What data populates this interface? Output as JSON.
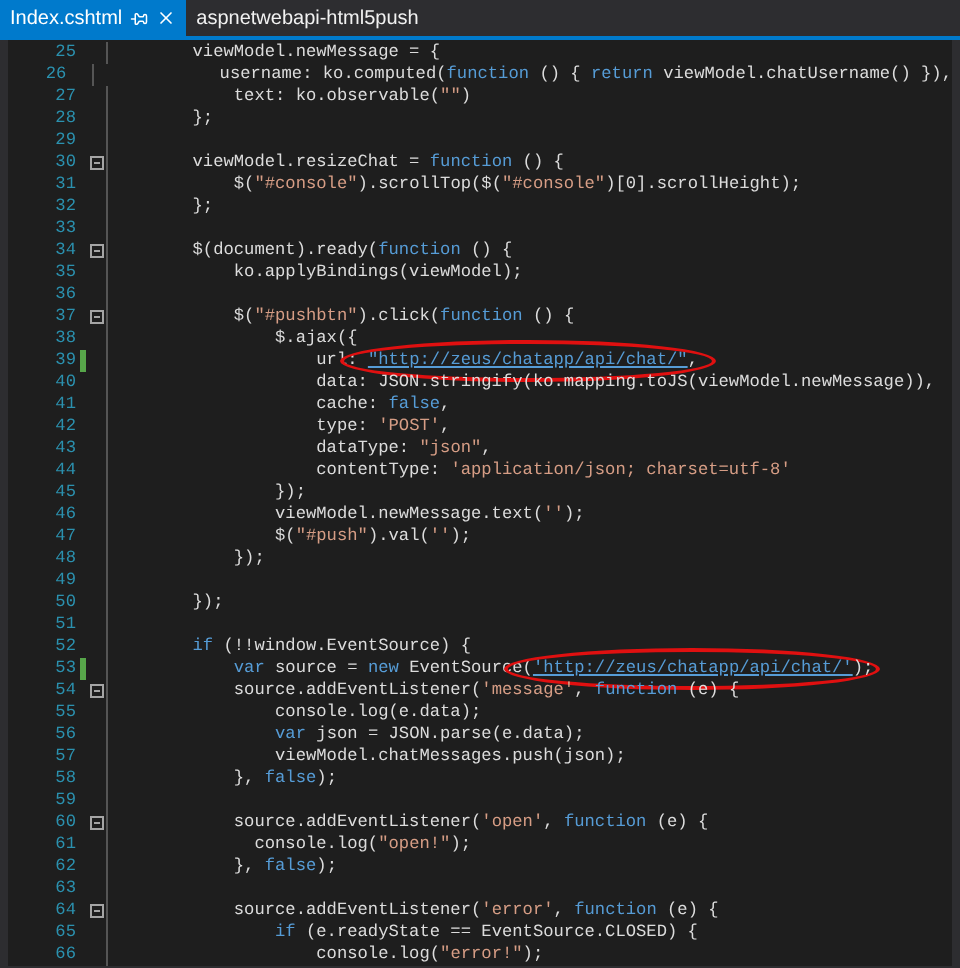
{
  "tabs": [
    {
      "label": "Index.cshtml",
      "selected": true,
      "pinnable": true,
      "closable": true
    },
    {
      "label": "aspnetwebapi-html5push",
      "selected": false,
      "pinnable": false,
      "closable": false
    }
  ],
  "editor": {
    "lines": [
      {
        "number": "25",
        "fold": false,
        "changed": false,
        "segments": [
          {
            "kind": "plain",
            "text": "        viewModel.newMessage = {"
          }
        ]
      },
      {
        "number": "26",
        "fold": false,
        "changed": false,
        "segments": [
          {
            "kind": "plain",
            "text": "            username: ko.computed("
          },
          {
            "kind": "keyword",
            "text": "function"
          },
          {
            "kind": "plain",
            "text": " () { "
          },
          {
            "kind": "keyword",
            "text": "return"
          },
          {
            "kind": "plain",
            "text": " viewModel.chatUsername() }),"
          }
        ]
      },
      {
        "number": "27",
        "fold": false,
        "changed": false,
        "segments": [
          {
            "kind": "plain",
            "text": "            text: ko.observable("
          },
          {
            "kind": "string",
            "text": "\"\""
          },
          {
            "kind": "plain",
            "text": ")"
          }
        ]
      },
      {
        "number": "28",
        "fold": false,
        "changed": false,
        "segments": [
          {
            "kind": "plain",
            "text": "        };"
          }
        ]
      },
      {
        "number": "29",
        "fold": false,
        "changed": false
      },
      {
        "number": "30",
        "fold": true,
        "changed": false,
        "segments": [
          {
            "kind": "plain",
            "text": "        viewModel.resizeChat = "
          },
          {
            "kind": "keyword",
            "text": "function"
          },
          {
            "kind": "plain",
            "text": " () {"
          }
        ]
      },
      {
        "number": "31",
        "fold": false,
        "changed": false,
        "segments": [
          {
            "kind": "plain",
            "text": "            $("
          },
          {
            "kind": "string",
            "text": "\"#console\""
          },
          {
            "kind": "plain",
            "text": ").scrollTop($("
          },
          {
            "kind": "string",
            "text": "\"#console\""
          },
          {
            "kind": "plain",
            "text": ")[0].scrollHeight);"
          }
        ]
      },
      {
        "number": "32",
        "fold": false,
        "changed": false,
        "segments": [
          {
            "kind": "plain",
            "text": "        };"
          }
        ]
      },
      {
        "number": "33",
        "fold": false,
        "changed": false
      },
      {
        "number": "34",
        "fold": true,
        "changed": false,
        "segments": [
          {
            "kind": "plain",
            "text": "        $(document).ready("
          },
          {
            "kind": "keyword",
            "text": "function"
          },
          {
            "kind": "plain",
            "text": " () {"
          }
        ]
      },
      {
        "number": "35",
        "fold": false,
        "changed": false,
        "segments": [
          {
            "kind": "plain",
            "text": "            ko.applyBindings(viewModel);"
          }
        ]
      },
      {
        "number": "36",
        "fold": false,
        "changed": false
      },
      {
        "number": "37",
        "fold": true,
        "changed": false,
        "segments": [
          {
            "kind": "plain",
            "text": "            $("
          },
          {
            "kind": "string",
            "text": "\"#pushbtn\""
          },
          {
            "kind": "plain",
            "text": ").click("
          },
          {
            "kind": "keyword",
            "text": "function"
          },
          {
            "kind": "plain",
            "text": " () {"
          }
        ]
      },
      {
        "number": "38",
        "fold": false,
        "changed": false,
        "segments": [
          {
            "kind": "plain",
            "text": "                $.ajax({"
          }
        ]
      },
      {
        "number": "39",
        "fold": false,
        "changed": true,
        "segments": [
          {
            "kind": "plain",
            "text": "                    url: "
          },
          {
            "kind": "link",
            "text": "\"http://zeus/chatapp/api/chat/\"",
            "circled": true
          },
          {
            "kind": "plain",
            "text": ","
          }
        ]
      },
      {
        "number": "40",
        "fold": false,
        "changed": false,
        "segments": [
          {
            "kind": "plain",
            "text": "                    data: JSON.stringify(ko.mapping.toJS(viewModel.newMessage)),"
          }
        ]
      },
      {
        "number": "41",
        "fold": false,
        "changed": false,
        "segments": [
          {
            "kind": "plain",
            "text": "                    cache: "
          },
          {
            "kind": "keyword",
            "text": "false"
          },
          {
            "kind": "plain",
            "text": ","
          }
        ]
      },
      {
        "number": "42",
        "fold": false,
        "changed": false,
        "segments": [
          {
            "kind": "plain",
            "text": "                    type: "
          },
          {
            "kind": "string",
            "text": "'POST'"
          },
          {
            "kind": "plain",
            "text": ","
          }
        ]
      },
      {
        "number": "43",
        "fold": false,
        "changed": false,
        "segments": [
          {
            "kind": "plain",
            "text": "                    dataType: "
          },
          {
            "kind": "string",
            "text": "\"json\""
          },
          {
            "kind": "plain",
            "text": ","
          }
        ]
      },
      {
        "number": "44",
        "fold": false,
        "changed": false,
        "segments": [
          {
            "kind": "plain",
            "text": "                    contentType: "
          },
          {
            "kind": "string",
            "text": "'application/json; charset=utf-8'"
          }
        ]
      },
      {
        "number": "45",
        "fold": false,
        "changed": false,
        "segments": [
          {
            "kind": "plain",
            "text": "                });"
          }
        ]
      },
      {
        "number": "46",
        "fold": false,
        "changed": false,
        "segments": [
          {
            "kind": "plain",
            "text": "                viewModel.newMessage.text("
          },
          {
            "kind": "string",
            "text": "''"
          },
          {
            "kind": "plain",
            "text": ");"
          }
        ]
      },
      {
        "number": "47",
        "fold": false,
        "changed": false,
        "segments": [
          {
            "kind": "plain",
            "text": "                $("
          },
          {
            "kind": "string",
            "text": "\"#push\""
          },
          {
            "kind": "plain",
            "text": ").val("
          },
          {
            "kind": "string",
            "text": "''"
          },
          {
            "kind": "plain",
            "text": ");"
          }
        ]
      },
      {
        "number": "48",
        "fold": false,
        "changed": false,
        "segments": [
          {
            "kind": "plain",
            "text": "            });"
          }
        ]
      },
      {
        "number": "49",
        "fold": false,
        "changed": false
      },
      {
        "number": "50",
        "fold": false,
        "changed": false,
        "segments": [
          {
            "kind": "plain",
            "text": "        });"
          }
        ]
      },
      {
        "number": "51",
        "fold": false,
        "changed": false
      },
      {
        "number": "52",
        "fold": false,
        "changed": false,
        "segments": [
          {
            "kind": "keyword",
            "text": "        if"
          },
          {
            "kind": "plain",
            "text": " (!!window.EventSource) {"
          }
        ]
      },
      {
        "number": "53",
        "fold": false,
        "changed": true,
        "segments": [
          {
            "kind": "keyword",
            "text": "            var"
          },
          {
            "kind": "plain",
            "text": " source = "
          },
          {
            "kind": "keyword",
            "text": "new"
          },
          {
            "kind": "plain",
            "text": " EventSource("
          },
          {
            "kind": "link",
            "text": "'http://zeus/chatapp/api/chat/'",
            "circled": true
          },
          {
            "kind": "plain",
            "text": ");"
          }
        ]
      },
      {
        "number": "54",
        "fold": true,
        "changed": false,
        "segments": [
          {
            "kind": "plain",
            "text": "            source.addEventListener("
          },
          {
            "kind": "string",
            "text": "'message'"
          },
          {
            "kind": "plain",
            "text": ", "
          },
          {
            "kind": "keyword",
            "text": "function"
          },
          {
            "kind": "plain",
            "text": " (e) {"
          }
        ]
      },
      {
        "number": "55",
        "fold": false,
        "changed": false,
        "segments": [
          {
            "kind": "plain",
            "text": "                console.log(e.data);"
          }
        ]
      },
      {
        "number": "56",
        "fold": false,
        "changed": false,
        "segments": [
          {
            "kind": "keyword",
            "text": "                var"
          },
          {
            "kind": "plain",
            "text": " json = JSON.parse(e.data);"
          }
        ]
      },
      {
        "number": "57",
        "fold": false,
        "changed": false,
        "segments": [
          {
            "kind": "plain",
            "text": "                viewModel.chatMessages.push(json);"
          }
        ]
      },
      {
        "number": "58",
        "fold": false,
        "changed": false,
        "segments": [
          {
            "kind": "plain",
            "text": "            }, "
          },
          {
            "kind": "keyword",
            "text": "false"
          },
          {
            "kind": "plain",
            "text": ");"
          }
        ]
      },
      {
        "number": "59",
        "fold": false,
        "changed": false
      },
      {
        "number": "60",
        "fold": true,
        "changed": false,
        "segments": [
          {
            "kind": "plain",
            "text": "            source.addEventListener("
          },
          {
            "kind": "string",
            "text": "'open'"
          },
          {
            "kind": "plain",
            "text": ", "
          },
          {
            "kind": "keyword",
            "text": "function"
          },
          {
            "kind": "plain",
            "text": " (e) {"
          }
        ]
      },
      {
        "number": "61",
        "fold": false,
        "changed": false,
        "segments": [
          {
            "kind": "plain",
            "text": "              console.log("
          },
          {
            "kind": "string",
            "text": "\"open!\""
          },
          {
            "kind": "plain",
            "text": ");"
          }
        ]
      },
      {
        "number": "62",
        "fold": false,
        "changed": false,
        "segments": [
          {
            "kind": "plain",
            "text": "            }, "
          },
          {
            "kind": "keyword",
            "text": "false"
          },
          {
            "kind": "plain",
            "text": ");"
          }
        ]
      },
      {
        "number": "63",
        "fold": false,
        "changed": false
      },
      {
        "number": "64",
        "fold": true,
        "changed": false,
        "segments": [
          {
            "kind": "plain",
            "text": "            source.addEventListener("
          },
          {
            "kind": "string",
            "text": "'error'"
          },
          {
            "kind": "plain",
            "text": ", "
          },
          {
            "kind": "keyword",
            "text": "function"
          },
          {
            "kind": "plain",
            "text": " (e) {"
          }
        ]
      },
      {
        "number": "65",
        "fold": false,
        "changed": false,
        "segments": [
          {
            "kind": "keyword",
            "text": "                if"
          },
          {
            "kind": "plain",
            "text": " (e.readyState == EventSource.CLOSED) {"
          }
        ]
      },
      {
        "number": "66",
        "fold": false,
        "changed": false,
        "segments": [
          {
            "kind": "plain",
            "text": "                    console.log("
          },
          {
            "kind": "string",
            "text": "\"error!\""
          },
          {
            "kind": "plain",
            "text": ");"
          }
        ]
      }
    ]
  }
}
